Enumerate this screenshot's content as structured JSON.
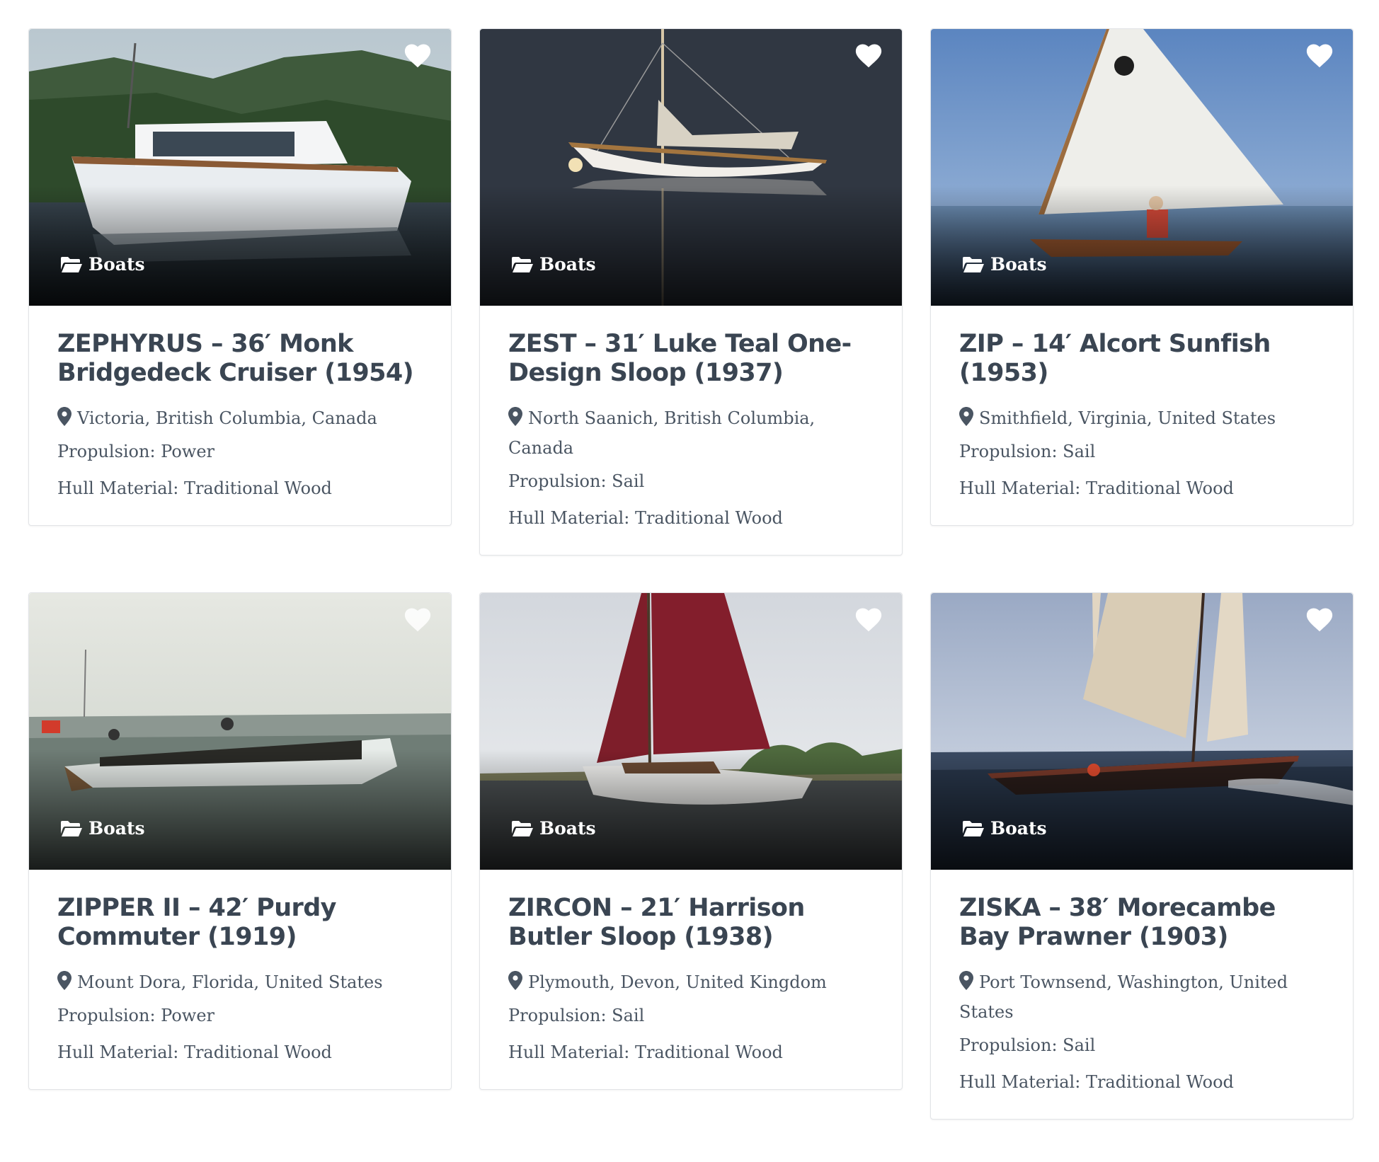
{
  "listings": [
    {
      "category": "Boats",
      "title": "ZEPHYRUS – 36′ Monk Bridgedeck Cruiser (1954)",
      "location": "Victoria, British Columbia, Canada",
      "propulsion": "Propulsion: Power",
      "hull": "Hull Material: Traditional Wood",
      "photo": "white motor cruiser on lake with forested hills"
    },
    {
      "category": "Boats",
      "title": "ZEST – 31′ Luke Teal One-Design Sloop (1937)",
      "location": "North Saanich, British Columbia, Canada",
      "propulsion": "Propulsion: Sail",
      "hull": "Hull Material: Traditional Wood",
      "photo": "white sloop reflected on dark calm water"
    },
    {
      "category": "Boats",
      "title": "ZIP – 14′ Alcort Sunfish (1953)",
      "location": "Smithfield, Virginia, United States",
      "propulsion": "Propulsion: Sail",
      "hull": "Hull Material: Traditional Wood",
      "photo": "small wooden sailboat with white sail"
    },
    {
      "category": "Boats",
      "title": "ZIPPER II – 42′ Purdy Commuter (1919)",
      "location": "Mount Dora, Florida, United States",
      "propulsion": "Propulsion: Power",
      "hull": "Hull Material: Traditional Wood",
      "photo": "vintage commuter launch with passengers"
    },
    {
      "category": "Boats",
      "title": "ZIRCON – 21′ Harrison Butler Sloop (1938)",
      "location": "Plymouth, Devon, United Kingdom",
      "propulsion": "Propulsion: Sail",
      "hull": "Hull Material: Traditional Wood",
      "photo": "white sloop with red sails at anchor"
    },
    {
      "category": "Boats",
      "title": "ZISKA – 38′ Morecambe Bay Prawner (1903)",
      "location": "Port Townsend, Washington, United States",
      "propulsion": "Propulsion: Sail",
      "hull": "Hull Material: Traditional Wood",
      "photo": "gaff cutter sailing in choppy water"
    }
  ],
  "icons": {
    "favorite": "heart-icon",
    "category": "folder-open-icon",
    "location": "map-pin-icon"
  },
  "colors": {
    "title": "#3a4552",
    "text": "#4a5562",
    "border": "#e2e4e7"
  }
}
